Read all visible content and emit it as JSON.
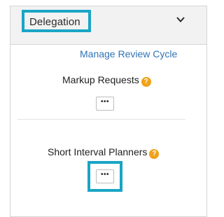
{
  "panel": {
    "title": "Delegation",
    "collapse_icon": "chevron-down-icon"
  },
  "manage_link": "Manage Review Cycle",
  "sections": [
    {
      "label": "Markup Requests",
      "help_icon": "question-circle-icon",
      "button_label": "•••"
    },
    {
      "label": "Short Interval Planners",
      "help_icon": "question-circle-icon",
      "button_label": "•••"
    }
  ],
  "colors": {
    "highlight": "#1aa5c5",
    "link": "#2f74b5",
    "help": "#f0a21a"
  }
}
